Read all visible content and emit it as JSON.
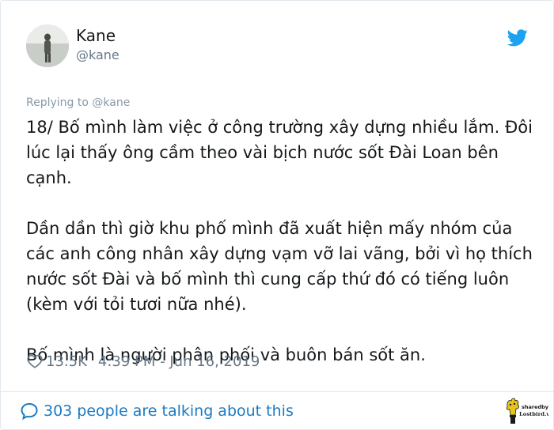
{
  "author": {
    "name": "Kane",
    "handle": "@kane"
  },
  "icons": {
    "brand": "twitter-bird-icon",
    "like": "heart-icon",
    "conversation": "speech-bubble-icon"
  },
  "colors": {
    "twitter_blue": "#1da1f2",
    "link_blue": "#1b7ac2",
    "secondary_text": "#657786",
    "replying_text": "#8899a6"
  },
  "tweet": {
    "replying_to": "Replying to @kane",
    "paragraphs": [
      "18/ Bố mình làm việc ở công trường xây dựng nhiều lắm. Đôi lúc lại thấy ông cầm theo vài bịch nước sốt Đài Loan bên cạnh.",
      "Dần dần thì giờ khu phố mình đã xuất hiện mấy nhóm của các anh công nhân xây dựng vạm vỡ lai vãng, bởi vì họ thích nước sốt Đài và bố mình thì cung cấp thứ đó có tiếng luôn (kèm với tỏi tươi nữa nhé).",
      "Bố mình là người phân phối và buôn bán sốt ăn."
    ],
    "likes": "13.5K",
    "timestamp": "4:39 PM - Jun 16, 2019"
  },
  "footer": {
    "talking_text": "303 people are talking about this"
  },
  "watermark": {
    "line1": "sharedby",
    "line2": "Lostbird.vn"
  }
}
